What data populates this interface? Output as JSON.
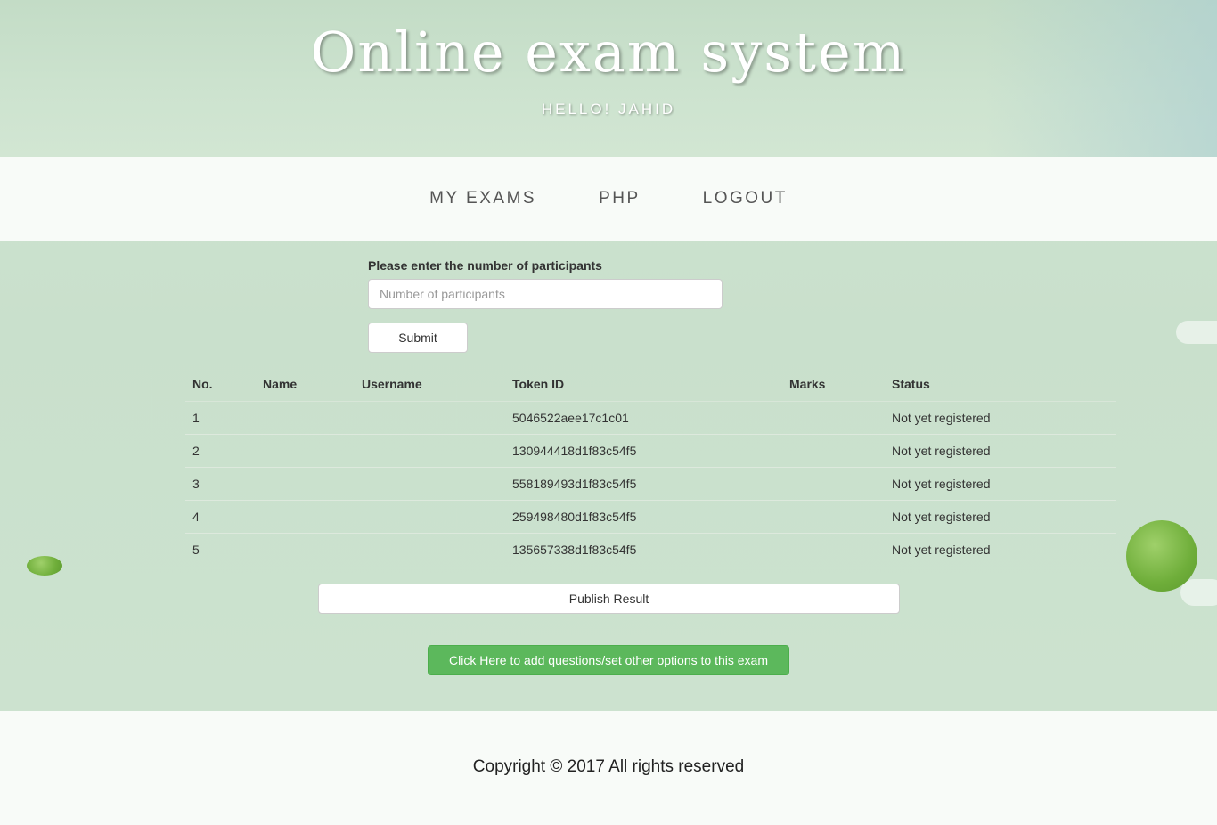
{
  "header": {
    "title": "Online exam system",
    "subtitle": "HELLO! JAHID"
  },
  "nav": {
    "items": [
      {
        "label": "MY EXAMS"
      },
      {
        "label": "PHP"
      },
      {
        "label": "LOGOUT"
      }
    ]
  },
  "form": {
    "label": "Please enter the number of participants",
    "input_placeholder": "Number of participants",
    "input_value": "",
    "submit_label": "Submit"
  },
  "table": {
    "headers": [
      "No.",
      "Name",
      "Username",
      "Token ID",
      "Marks",
      "Status"
    ],
    "rows": [
      {
        "no": "1",
        "name": "",
        "username": "",
        "token": "5046522aee17c1c01",
        "marks": "",
        "status": "Not yet registered"
      },
      {
        "no": "2",
        "name": "",
        "username": "",
        "token": "130944418d1f83c54f5",
        "marks": "",
        "status": "Not yet registered"
      },
      {
        "no": "3",
        "name": "",
        "username": "",
        "token": "558189493d1f83c54f5",
        "marks": "",
        "status": "Not yet registered"
      },
      {
        "no": "4",
        "name": "",
        "username": "",
        "token": "259498480d1f83c54f5",
        "marks": "",
        "status": "Not yet registered"
      },
      {
        "no": "5",
        "name": "",
        "username": "",
        "token": "135657338d1f83c54f5",
        "marks": "",
        "status": "Not yet registered"
      }
    ]
  },
  "actions": {
    "publish_label": "Publish Result",
    "options_label": "Click Here to add questions/set other options to this exam"
  },
  "footer": {
    "copyright": "Copyright © 2017 All rights reserved"
  },
  "colors": {
    "background": "#cde3d0",
    "primary_button": "#5cb85c",
    "nav_text": "#555555",
    "title_text": "#ffffff"
  }
}
